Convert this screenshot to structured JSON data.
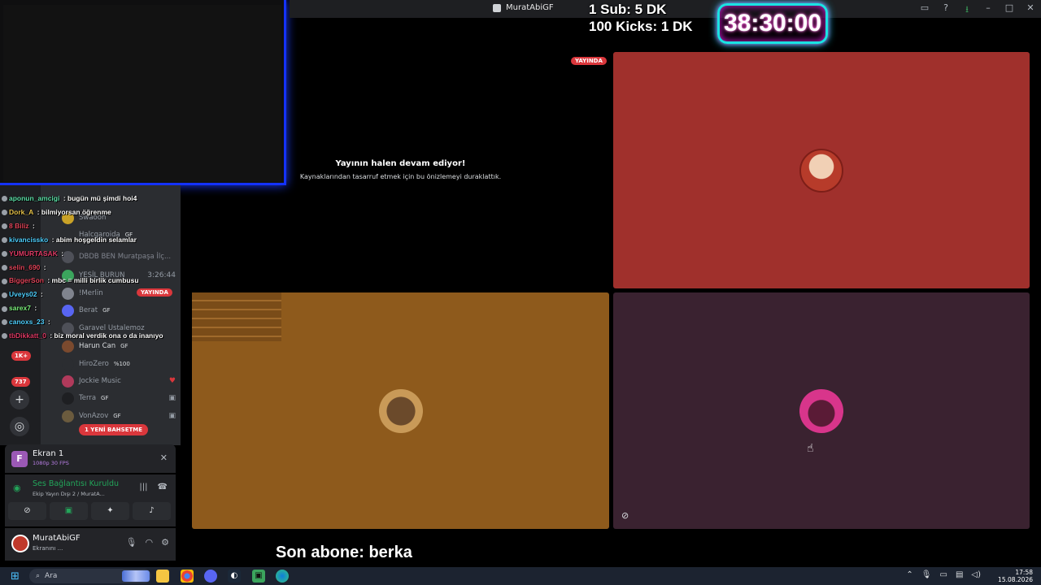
{
  "window": {
    "title": "MuratAbiGF"
  },
  "overlay": {
    "sub_rule": "1 Sub: 5 DK",
    "kick_rule": "100 Kicks: 1 DK",
    "timer": "38:30:00",
    "last_sub": "Son abone: berka"
  },
  "stream": {
    "live_label": "YAYINDA",
    "paused_title": "Yayının halen devam ediyor!",
    "paused_subtitle": "Kaynaklarından tasarruf etmek için bu önizlemeyi duraklattık."
  },
  "chat": [
    {
      "user": "aponun_amcigi",
      "message": "bugün mü şimdi hoi4",
      "color": "#5de0a8"
    },
    {
      "user": "Dork_A",
      "message": "bilmiyorsan öğrenme",
      "color": "#e6c24a"
    },
    {
      "user": "8 Biliz",
      "message": "",
      "color": "#e0455a"
    },
    {
      "user": "kivancissko",
      "message": "abim hoşgeldin selamlar",
      "color": "#4fd0ff"
    },
    {
      "user": "YUMURTASAK",
      "message": "",
      "color": "#e03b66"
    },
    {
      "user": "selin_690",
      "message": "",
      "color": "#e0455a"
    },
    {
      "user": "BiggerSon",
      "message": "mbc = milli birlik cumbusu",
      "color": "#e0455a"
    },
    {
      "user": "Uveys02",
      "message": "",
      "color": "#4fd0ff"
    },
    {
      "user": "sarex7",
      "message": "",
      "color": "#7cf07c"
    },
    {
      "user": "canoxs_23",
      "message": "",
      "color": "#4fd0ff"
    },
    {
      "user": "tbDikkatt_0",
      "message": "biz moral verdik ona o da inanıyo",
      "color": "#e03b66"
    }
  ],
  "sidebar": {
    "badges": [
      "1K+",
      "737"
    ],
    "members": [
      {
        "name": "Swaoon",
        "tag": ""
      },
      {
        "name": "Halcgaroida",
        "tag": "GF"
      },
      {
        "name": "DBDB BEN Muratpaşa İlç...",
        "tag": ""
      },
      {
        "name": "YESİL BURUN",
        "tag": ""
      },
      {
        "name": "!Merlin",
        "tag": ""
      },
      {
        "name": "Berat",
        "tag": "GF"
      },
      {
        "name": "Garavel Ustalemoz",
        "tag": ""
      },
      {
        "name": "Harun Can",
        "tag": "GF"
      },
      {
        "name": "HiroZero",
        "tag": "%100"
      },
      {
        "name": "Jockie Music",
        "tag": ""
      },
      {
        "name": "Terra",
        "tag": "GF"
      },
      {
        "name": "VonAzov",
        "tag": "GF"
      }
    ],
    "member_time": "3:26:44",
    "live_badge": "YAYINDA",
    "mention_badge": "1 YENİ BAHSETME"
  },
  "panels": {
    "stream_title": "Ekran 1",
    "stream_quality": "1080p 30 FPS",
    "voice_status": "Ses Bağlantısı Kuruldu",
    "voice_channel": "Ekip Yayın Dışı 2 / MuratA...",
    "user_name": "MuratAbiGF",
    "user_status": "Ekranını ..."
  },
  "taskbar": {
    "search_placeholder": "Ara",
    "time": "17:58",
    "date": "15.08.2026"
  },
  "colors": {
    "tile_red": "#a0302c",
    "tile_orange": "#8e5a1c",
    "tile_plum": "#3a2230",
    "timer_glow": "#1ae3e3",
    "accent_live": "#da373c"
  }
}
